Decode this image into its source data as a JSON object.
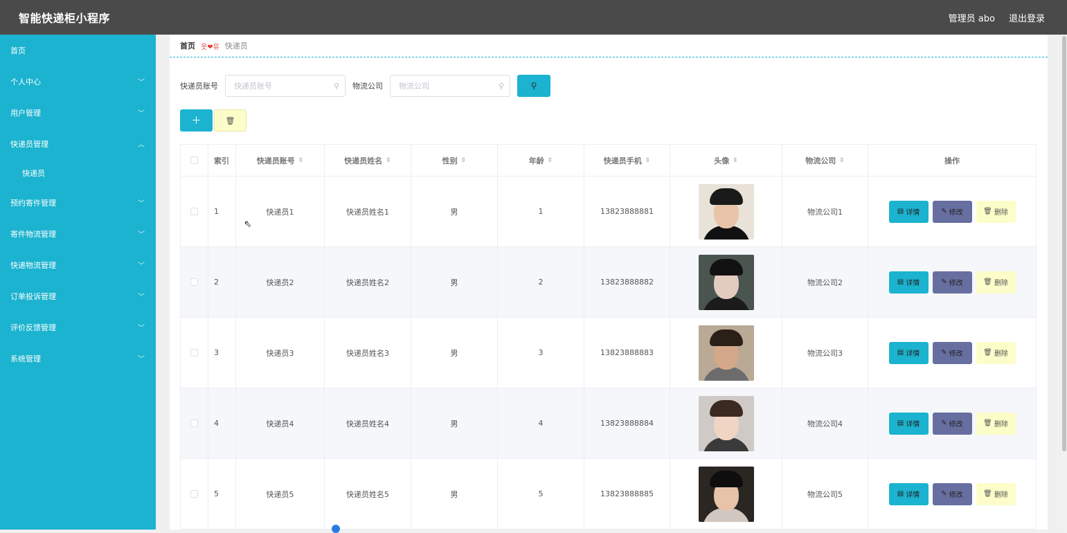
{
  "header": {
    "title": "智能快递柜小程序",
    "user_label": "管理员 abo",
    "logout_label": "退出登录"
  },
  "sidebar": {
    "items": [
      {
        "label": "首页",
        "expandable": false
      },
      {
        "label": "个人中心",
        "expandable": true
      },
      {
        "label": "用户管理",
        "expandable": true
      },
      {
        "label": "快递员管理",
        "expandable": true,
        "expanded": true
      },
      {
        "label": "快递员",
        "sub": true
      },
      {
        "label": "预约寄件管理",
        "expandable": true
      },
      {
        "label": "寄件物流管理",
        "expandable": true
      },
      {
        "label": "快递物流管理",
        "expandable": true
      },
      {
        "label": "订单投诉管理",
        "expandable": true
      },
      {
        "label": "评价反馈管理",
        "expandable": true
      },
      {
        "label": "系统管理",
        "expandable": true
      }
    ]
  },
  "breadcrumb": {
    "home": "首页",
    "separator": "웃❤유",
    "current": "快递员"
  },
  "search": {
    "account_label": "快递员账号",
    "account_placeholder": "快递员账号",
    "company_label": "物流公司",
    "company_placeholder": "物流公司"
  },
  "actions": {
    "add_label": "＋",
    "delete_label": "🗑"
  },
  "table": {
    "headers": [
      "索引",
      "快递员账号",
      "快递员姓名",
      "性别",
      "年龄",
      "快递员手机",
      "头像",
      "物流公司",
      "操作"
    ],
    "rows": [
      {
        "index": "1",
        "account": "快递员1",
        "name": "快递员姓名1",
        "sex": "男",
        "age": "1",
        "phone": "13823888881",
        "company": "物流公司1"
      },
      {
        "index": "2",
        "account": "快递员2",
        "name": "快递员姓名2",
        "sex": "男",
        "age": "2",
        "phone": "13823888882",
        "company": "物流公司2"
      },
      {
        "index": "3",
        "account": "快递员3",
        "name": "快递员姓名3",
        "sex": "男",
        "age": "3",
        "phone": "13823888883",
        "company": "物流公司3"
      },
      {
        "index": "4",
        "account": "快递员4",
        "name": "快递员姓名4",
        "sex": "男",
        "age": "4",
        "phone": "13823888884",
        "company": "物流公司4"
      },
      {
        "index": "5",
        "account": "快递员5",
        "name": "快递员姓名5",
        "sex": "男",
        "age": "5",
        "phone": "13823888885",
        "company": "物流公司5"
      }
    ],
    "ops": {
      "detail": "详情",
      "edit": "修改",
      "remove": "删除"
    }
  },
  "colors": {
    "accent": "#1bb3cf",
    "header_bg": "#4a4a4a",
    "edit_btn": "#676fa0",
    "delete_btn": "#fdfdc9"
  }
}
